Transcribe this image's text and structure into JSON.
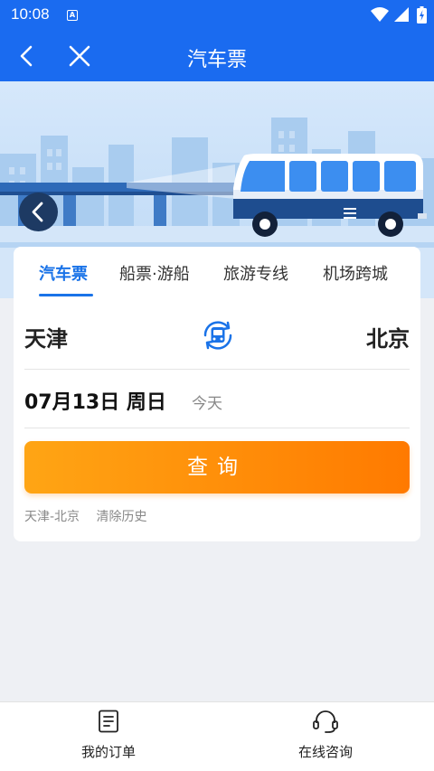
{
  "status": {
    "time": "10:08",
    "notif_letter": "A"
  },
  "nav": {
    "title": "汽车票"
  },
  "tabs": [
    "汽车票",
    "船票·游船",
    "旅游专线",
    "机场跨城"
  ],
  "route": {
    "from": "天津",
    "to": "北京"
  },
  "date": {
    "main": "07月13日 周日",
    "sub": "今天"
  },
  "search": {
    "label": "查询"
  },
  "history": {
    "item": "天津-北京",
    "clear": "清除历史"
  },
  "bottom": {
    "orders": "我的订单",
    "consult": "在线咨询"
  },
  "colors": {
    "brand": "#1a6bf0",
    "accent": "#ff8a00",
    "tab_active": "#1a73e8"
  }
}
